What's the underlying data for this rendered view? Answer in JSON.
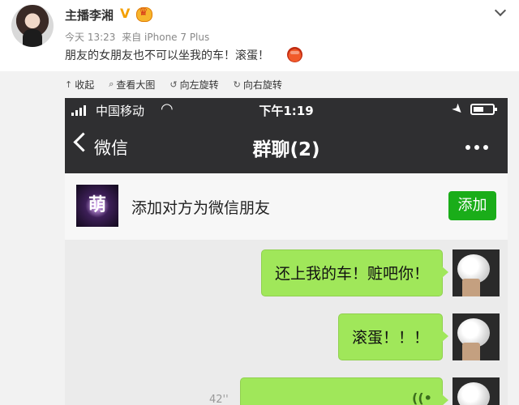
{
  "post": {
    "username": "主播李湘",
    "verified_badge": "V",
    "time": "今天 13:23",
    "source": "来自 iPhone 7 Plus",
    "text": "朋友的女朋友也不可以坐我的车！滚蛋！",
    "icons": [
      "avatar",
      "vip-badge",
      "crown-badge",
      "collapse-chevron",
      "angry-emoji"
    ]
  },
  "toolbar": {
    "items": [
      {
        "icon": "↑",
        "label": "收起"
      },
      {
        "icon": "⌕",
        "label": "查看大图"
      },
      {
        "icon": "↺",
        "label": "向左旋转"
      },
      {
        "icon": "↻",
        "label": "向右旋转"
      }
    ]
  },
  "phone": {
    "status": {
      "carrier": "中国移动",
      "time": "下午1:19"
    },
    "nav": {
      "back_label": "微信",
      "title": "群聊(2)",
      "more": "•••"
    },
    "banner": {
      "avatar_text": "萌",
      "text": "添加对方为微信朋友",
      "add_label": "添加"
    },
    "messages": [
      {
        "text": "还上我的车！赃吧你！"
      },
      {
        "text": "滚蛋！！！"
      },
      {
        "text": "",
        "type": "voice"
      }
    ],
    "voice_duration": "42''",
    "voice_icon": "((•"
  },
  "colors": {
    "weibo_bg": "#f2f2f2",
    "wechat_dark": "#2f2f31",
    "wechat_green": "#1aad19",
    "bubble_green": "#a0e75a"
  }
}
